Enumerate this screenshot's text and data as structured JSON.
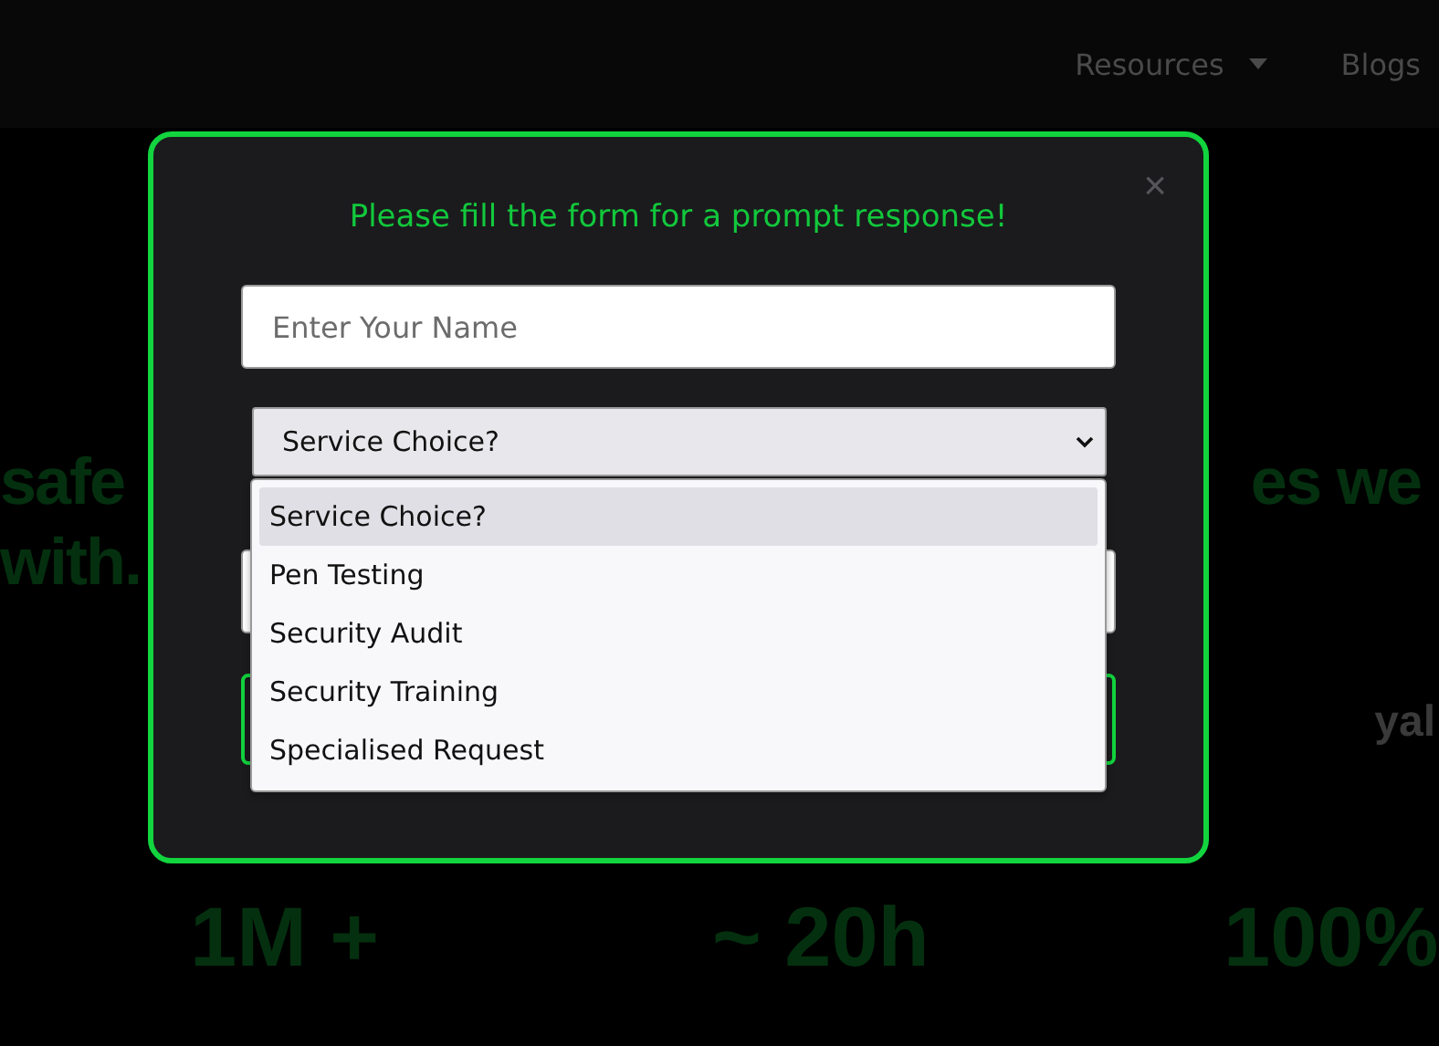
{
  "nav": {
    "items": [
      {
        "label": "Resources",
        "has_menu": true
      },
      {
        "label": "Blogs",
        "has_menu": false
      }
    ]
  },
  "background": {
    "hero_left": [
      "safe",
      "with."
    ],
    "hero_right": [
      "es we"
    ],
    "logo_fragment": "yal",
    "stats": [
      "1M +",
      "~ 20h",
      "100%"
    ]
  },
  "modal": {
    "close": "×",
    "title": "Please fill the form for a prompt response!",
    "name_field": {
      "placeholder": "Enter Your Name"
    },
    "service_select": {
      "value": "Service Choice?",
      "expanded": true,
      "options": [
        {
          "label": "Service Choice?",
          "selected": true
        },
        {
          "label": "Pen Testing",
          "selected": false
        },
        {
          "label": "Security Audit",
          "selected": false
        },
        {
          "label": "Security Training",
          "selected": false
        },
        {
          "label": "Specialised Request",
          "selected": false
        }
      ]
    }
  }
}
